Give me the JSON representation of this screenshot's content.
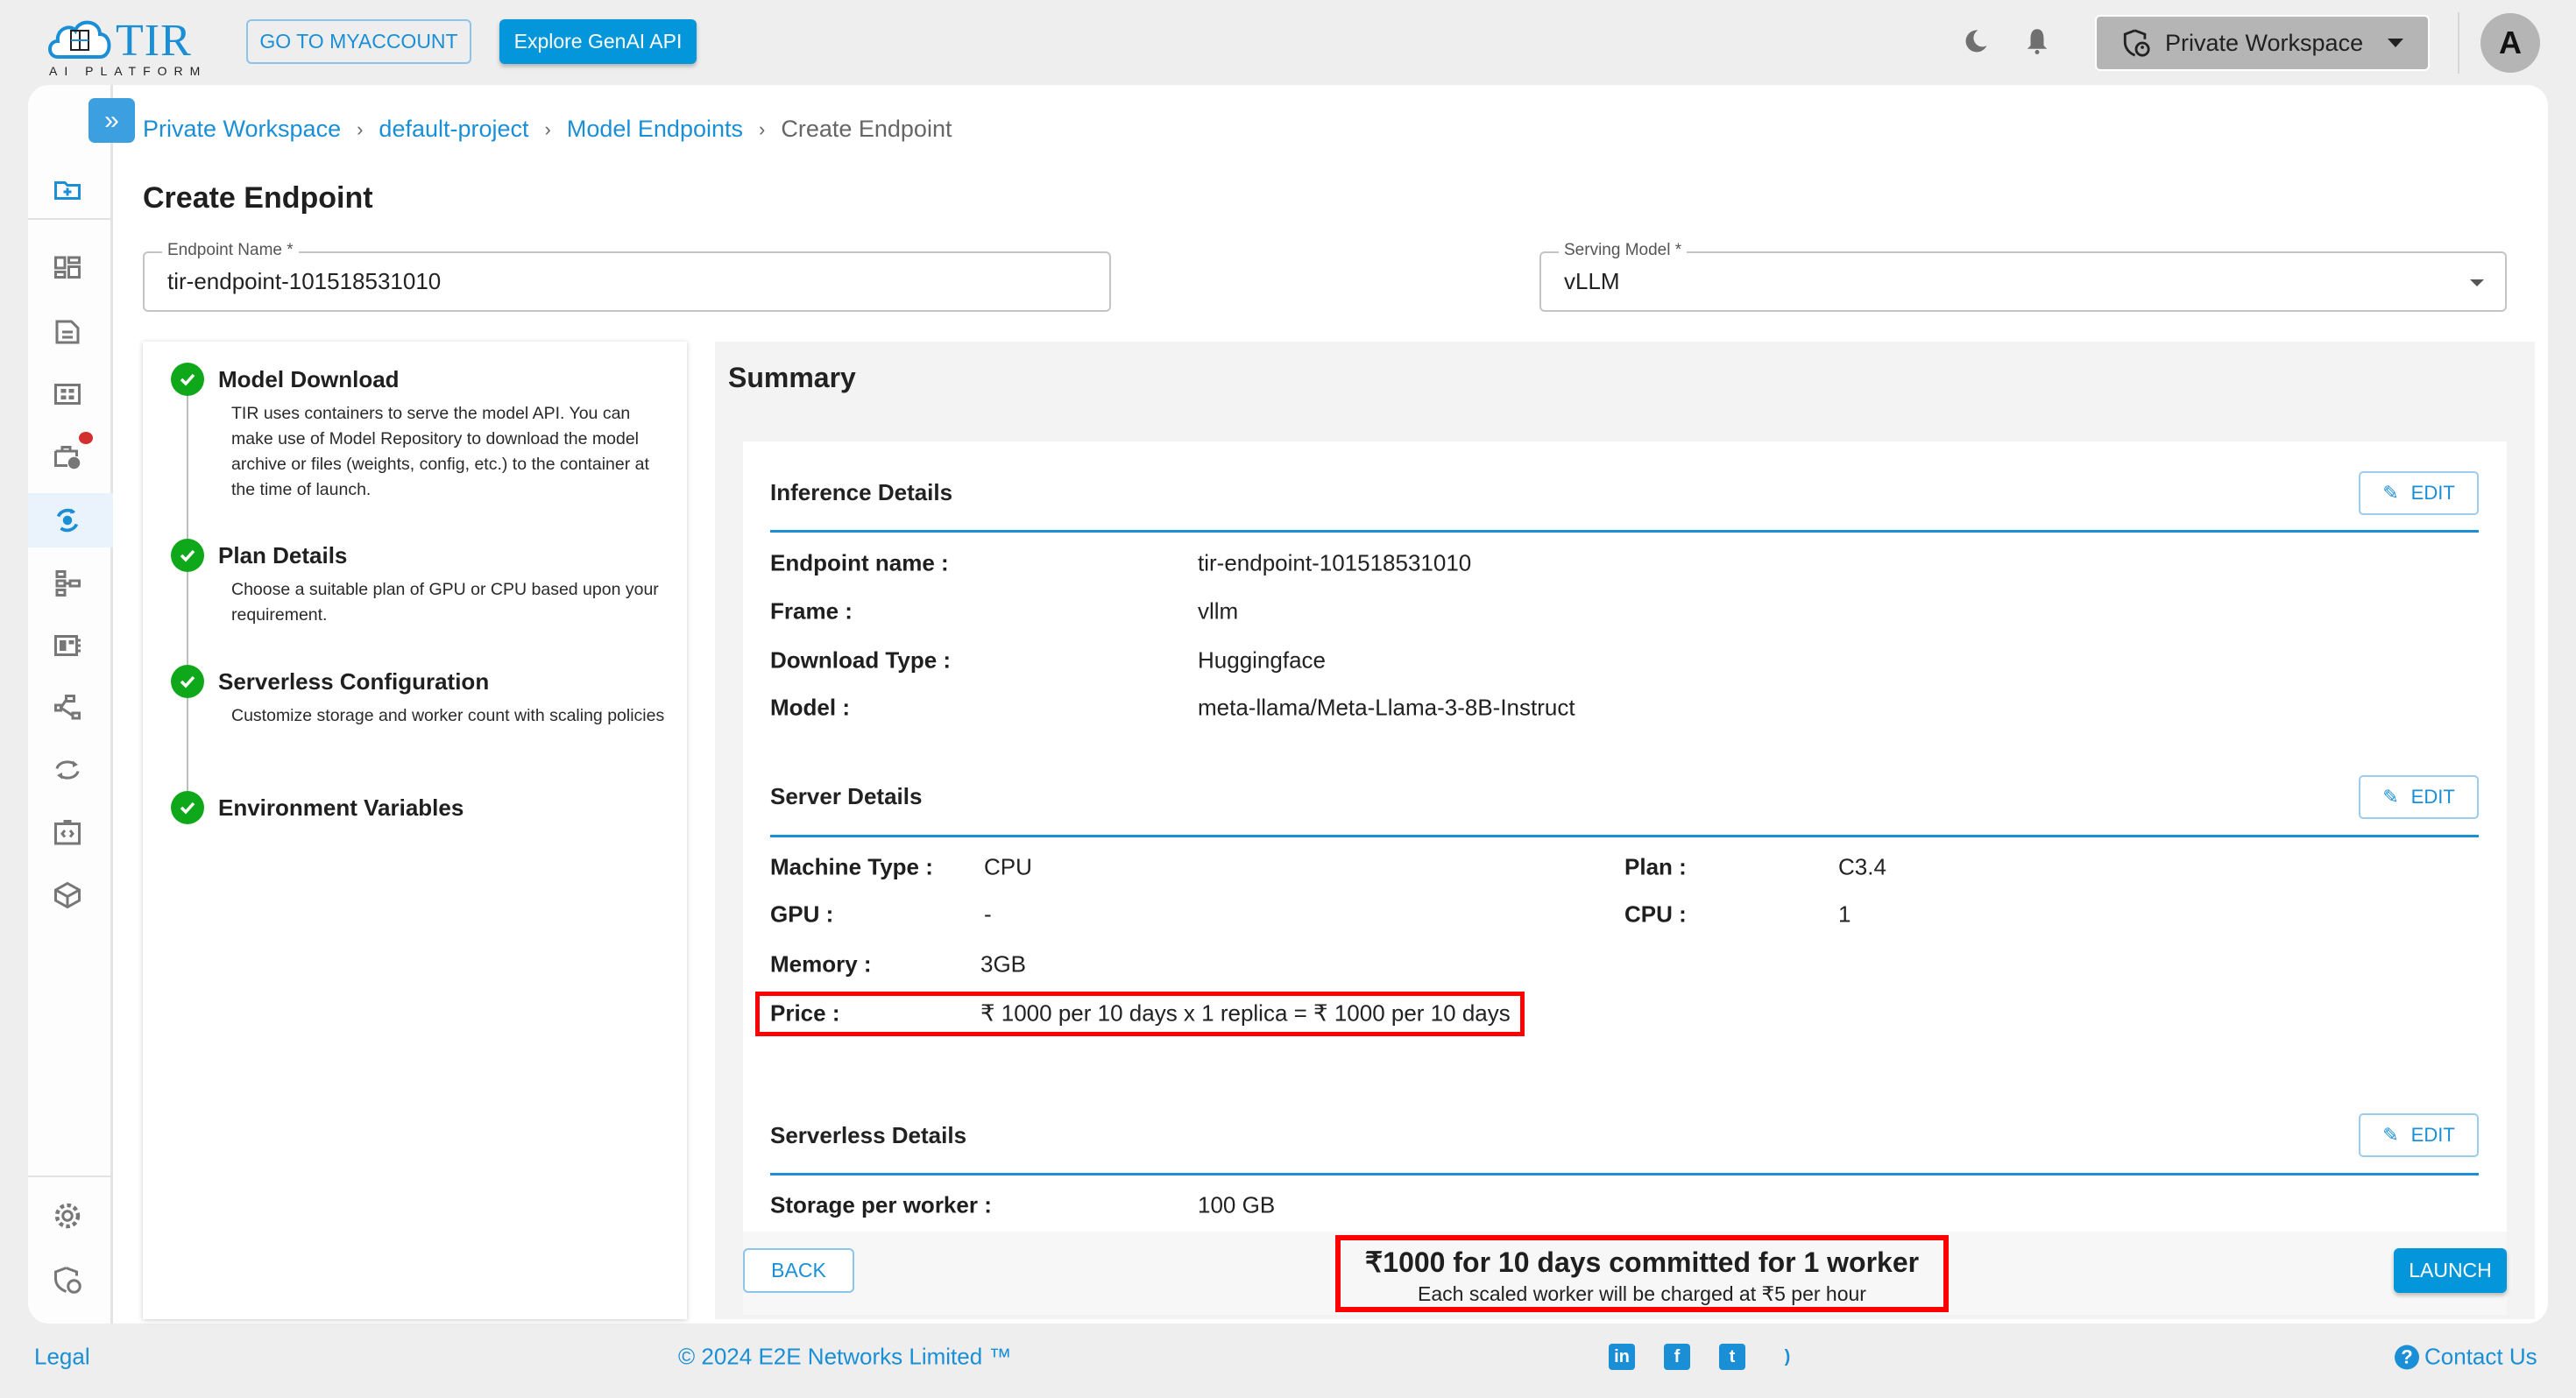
{
  "header": {
    "logo_text": "TIR",
    "logo_subtext": "AI PLATFORM",
    "logo_badge": "E2E Cloud",
    "myaccount_label": "GO TO MYACCOUNT",
    "genai_label": "Explore GenAI API",
    "workspace_label": "Private Workspace",
    "avatar_initial": "A"
  },
  "sidebar": {
    "items": [
      {
        "icon": "folder-plus-icon"
      },
      {
        "icon": "dashboard-icon"
      },
      {
        "icon": "document-icon"
      },
      {
        "icon": "grid-icon"
      },
      {
        "icon": "briefcase-clock-icon",
        "badge": true
      },
      {
        "icon": "model-endpoint-icon",
        "active": true
      },
      {
        "icon": "pipeline-icon"
      },
      {
        "icon": "registry-icon"
      },
      {
        "icon": "share-icon"
      },
      {
        "icon": "sync-icon"
      },
      {
        "icon": "code-box-icon"
      },
      {
        "icon": "cube-icon"
      },
      {
        "icon": "settings-icon"
      },
      {
        "icon": "shield-user-icon"
      }
    ],
    "badge_color": "#d32f2f"
  },
  "breadcrumb": {
    "items": [
      "Private Workspace",
      "default-project",
      "Model Endpoints"
    ],
    "current": "Create Endpoint",
    "separator": "›"
  },
  "page_title": "Create Endpoint",
  "form": {
    "endpoint_name_label": "Endpoint Name *",
    "endpoint_name_value": "tir-endpoint-101518531010",
    "serving_model_label": "Serving Model *",
    "serving_model_value": "vLLM"
  },
  "steps": [
    {
      "title": "Model Download",
      "desc": "TIR uses containers to serve the model API. You can make use of Model Repository to download the model archive or files (weights, config, etc.) to the container at the time of launch.",
      "done": true
    },
    {
      "title": "Plan Details",
      "desc": "Choose a suitable plan of GPU or CPU based upon your requirement.",
      "done": true
    },
    {
      "title": "Serverless Configuration",
      "desc": "Customize storage and worker count with scaling policies",
      "done": true
    },
    {
      "title": "Environment Variables",
      "desc": "",
      "done": true
    }
  ],
  "summary": {
    "title": "Summary",
    "edit_label": "EDIT",
    "inference": {
      "title": "Inference Details",
      "rows": [
        {
          "label": "Endpoint name :",
          "value": "tir-endpoint-101518531010"
        },
        {
          "label": "Frame :",
          "value": "vllm"
        },
        {
          "label": "Download Type :",
          "value": "Huggingface"
        },
        {
          "label": "Model :",
          "value": "meta-llama/Meta-Llama-3-8B-Instruct"
        }
      ]
    },
    "server": {
      "title": "Server Details",
      "machine_type_label": "Machine Type :",
      "machine_type": "CPU",
      "plan_label": "Plan :",
      "plan": "C3.4",
      "gpu_label": "GPU :",
      "gpu": "-",
      "cpu_label": "CPU :",
      "cpu": "1",
      "memory_label": "Memory :",
      "memory": "3GB",
      "price_label": "Price :",
      "price": "₹ 1000 per 10 days x 1 replica = ₹ 1000 per 10 days"
    },
    "serverless": {
      "title": "Serverless Details",
      "storage_label": "Storage per worker :",
      "storage": "100 GB"
    },
    "back_label": "BACK",
    "launch_label": "LAUNCH",
    "commit_main": "₹1000 for 10 days committed for 1 worker",
    "commit_sub": "Each scaled worker will be charged at ₹5 per hour",
    "highlight_color": "#ff0000"
  },
  "footer": {
    "legal": "Legal",
    "copyright": "© 2024 E2E Networks Limited ™",
    "social": [
      "linkedin-icon",
      "facebook-icon",
      "twitter-icon",
      "rss-icon"
    ],
    "contact": "Contact Us"
  },
  "colors": {
    "accent": "#0396db",
    "success": "#0fa81a"
  }
}
